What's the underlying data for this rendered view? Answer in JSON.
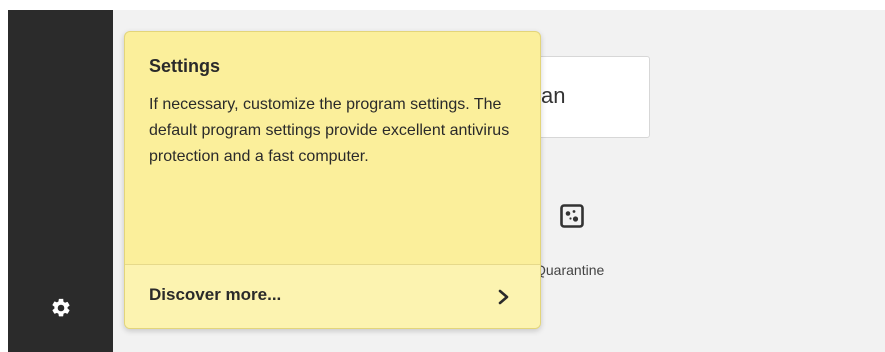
{
  "sidebar": {
    "settings_icon": "gear-icon"
  },
  "main": {
    "scan_label": "an",
    "quarantine": {
      "icon": "quarantine-icon",
      "label": "Quarantine"
    }
  },
  "tooltip": {
    "title": "Settings",
    "body": "If necessary, customize the program settings. The default program settings provide excellent antivirus protection and a fast computer.",
    "discover_label": "Discover more...",
    "chevron_icon": "chevron-right-icon",
    "background_color": "#fbef9b"
  }
}
